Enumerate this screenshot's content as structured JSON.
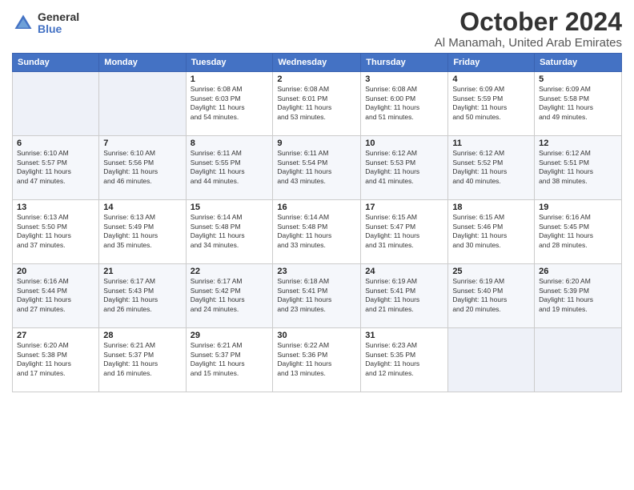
{
  "logo": {
    "general": "General",
    "blue": "Blue"
  },
  "title": "October 2024",
  "location": "Al Manamah, United Arab Emirates",
  "headers": [
    "Sunday",
    "Monday",
    "Tuesday",
    "Wednesday",
    "Thursday",
    "Friday",
    "Saturday"
  ],
  "weeks": [
    [
      {
        "day": "",
        "info": ""
      },
      {
        "day": "",
        "info": ""
      },
      {
        "day": "1",
        "info": "Sunrise: 6:08 AM\nSunset: 6:03 PM\nDaylight: 11 hours\nand 54 minutes."
      },
      {
        "day": "2",
        "info": "Sunrise: 6:08 AM\nSunset: 6:01 PM\nDaylight: 11 hours\nand 53 minutes."
      },
      {
        "day": "3",
        "info": "Sunrise: 6:08 AM\nSunset: 6:00 PM\nDaylight: 11 hours\nand 51 minutes."
      },
      {
        "day": "4",
        "info": "Sunrise: 6:09 AM\nSunset: 5:59 PM\nDaylight: 11 hours\nand 50 minutes."
      },
      {
        "day": "5",
        "info": "Sunrise: 6:09 AM\nSunset: 5:58 PM\nDaylight: 11 hours\nand 49 minutes."
      }
    ],
    [
      {
        "day": "6",
        "info": "Sunrise: 6:10 AM\nSunset: 5:57 PM\nDaylight: 11 hours\nand 47 minutes."
      },
      {
        "day": "7",
        "info": "Sunrise: 6:10 AM\nSunset: 5:56 PM\nDaylight: 11 hours\nand 46 minutes."
      },
      {
        "day": "8",
        "info": "Sunrise: 6:11 AM\nSunset: 5:55 PM\nDaylight: 11 hours\nand 44 minutes."
      },
      {
        "day": "9",
        "info": "Sunrise: 6:11 AM\nSunset: 5:54 PM\nDaylight: 11 hours\nand 43 minutes."
      },
      {
        "day": "10",
        "info": "Sunrise: 6:12 AM\nSunset: 5:53 PM\nDaylight: 11 hours\nand 41 minutes."
      },
      {
        "day": "11",
        "info": "Sunrise: 6:12 AM\nSunset: 5:52 PM\nDaylight: 11 hours\nand 40 minutes."
      },
      {
        "day": "12",
        "info": "Sunrise: 6:12 AM\nSunset: 5:51 PM\nDaylight: 11 hours\nand 38 minutes."
      }
    ],
    [
      {
        "day": "13",
        "info": "Sunrise: 6:13 AM\nSunset: 5:50 PM\nDaylight: 11 hours\nand 37 minutes."
      },
      {
        "day": "14",
        "info": "Sunrise: 6:13 AM\nSunset: 5:49 PM\nDaylight: 11 hours\nand 35 minutes."
      },
      {
        "day": "15",
        "info": "Sunrise: 6:14 AM\nSunset: 5:48 PM\nDaylight: 11 hours\nand 34 minutes."
      },
      {
        "day": "16",
        "info": "Sunrise: 6:14 AM\nSunset: 5:48 PM\nDaylight: 11 hours\nand 33 minutes."
      },
      {
        "day": "17",
        "info": "Sunrise: 6:15 AM\nSunset: 5:47 PM\nDaylight: 11 hours\nand 31 minutes."
      },
      {
        "day": "18",
        "info": "Sunrise: 6:15 AM\nSunset: 5:46 PM\nDaylight: 11 hours\nand 30 minutes."
      },
      {
        "day": "19",
        "info": "Sunrise: 6:16 AM\nSunset: 5:45 PM\nDaylight: 11 hours\nand 28 minutes."
      }
    ],
    [
      {
        "day": "20",
        "info": "Sunrise: 6:16 AM\nSunset: 5:44 PM\nDaylight: 11 hours\nand 27 minutes."
      },
      {
        "day": "21",
        "info": "Sunrise: 6:17 AM\nSunset: 5:43 PM\nDaylight: 11 hours\nand 26 minutes."
      },
      {
        "day": "22",
        "info": "Sunrise: 6:17 AM\nSunset: 5:42 PM\nDaylight: 11 hours\nand 24 minutes."
      },
      {
        "day": "23",
        "info": "Sunrise: 6:18 AM\nSunset: 5:41 PM\nDaylight: 11 hours\nand 23 minutes."
      },
      {
        "day": "24",
        "info": "Sunrise: 6:19 AM\nSunset: 5:41 PM\nDaylight: 11 hours\nand 21 minutes."
      },
      {
        "day": "25",
        "info": "Sunrise: 6:19 AM\nSunset: 5:40 PM\nDaylight: 11 hours\nand 20 minutes."
      },
      {
        "day": "26",
        "info": "Sunrise: 6:20 AM\nSunset: 5:39 PM\nDaylight: 11 hours\nand 19 minutes."
      }
    ],
    [
      {
        "day": "27",
        "info": "Sunrise: 6:20 AM\nSunset: 5:38 PM\nDaylight: 11 hours\nand 17 minutes."
      },
      {
        "day": "28",
        "info": "Sunrise: 6:21 AM\nSunset: 5:37 PM\nDaylight: 11 hours\nand 16 minutes."
      },
      {
        "day": "29",
        "info": "Sunrise: 6:21 AM\nSunset: 5:37 PM\nDaylight: 11 hours\nand 15 minutes."
      },
      {
        "day": "30",
        "info": "Sunrise: 6:22 AM\nSunset: 5:36 PM\nDaylight: 11 hours\nand 13 minutes."
      },
      {
        "day": "31",
        "info": "Sunrise: 6:23 AM\nSunset: 5:35 PM\nDaylight: 11 hours\nand 12 minutes."
      },
      {
        "day": "",
        "info": ""
      },
      {
        "day": "",
        "info": ""
      }
    ]
  ]
}
